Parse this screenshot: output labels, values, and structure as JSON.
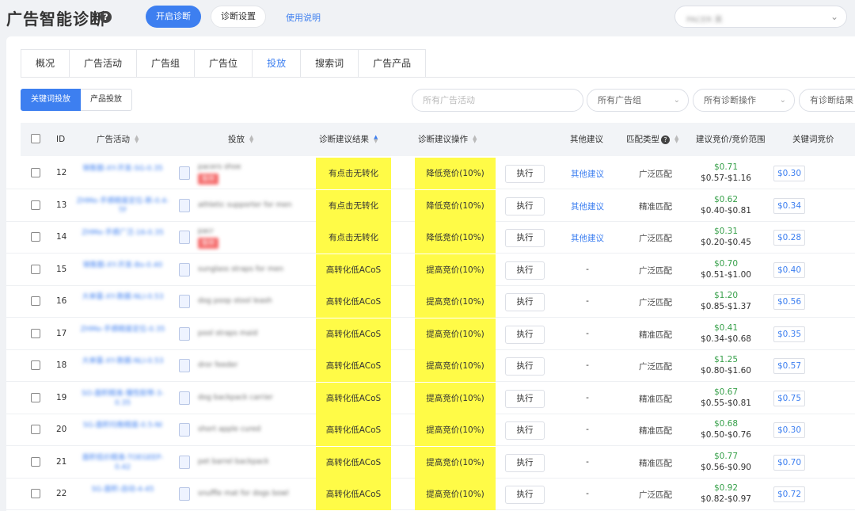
{
  "header": {
    "title": "广告智能诊断",
    "start_btn": "开启诊断",
    "settings_btn": "诊断设置",
    "guide_link": "使用说明",
    "store_value": "PACER 美"
  },
  "tabs": [
    "概况",
    "广告活动",
    "广告组",
    "广告位",
    "投放",
    "搜索词",
    "广告产品"
  ],
  "active_tab": "投放",
  "segment": {
    "keyword": "关键词投放",
    "product": "产品投放"
  },
  "filters": {
    "campaign_placeholder": "所有广告活动",
    "group": "所有广告组",
    "operation": "所有诊断操作",
    "result": "有诊断结果"
  },
  "columns": {
    "id": "ID",
    "campaign": "广告活动",
    "target": "投放",
    "result": "诊断建议结果",
    "operation": "诊断建议操作",
    "other": "其他建议",
    "match": "匹配类型",
    "suggest": "建议竞价/竞价范围",
    "bid": "关键词竞价"
  },
  "exec_label": "执行",
  "rows": [
    {
      "id": "12",
      "campaign": "销售额-XY-开发-SG-0.35",
      "target": "pacers shoe",
      "badge": "暂停",
      "result": "有点击无转化",
      "operation": "降低竞价(10%)",
      "other": "其他建议",
      "match": "广泛匹配",
      "price": "$0.71",
      "range": "$0.57-$1.16",
      "bid": "$0.30"
    },
    {
      "id": "13",
      "campaign": "ZHMe-手感精度定位-新-0.4-TF",
      "target": "athletic supporter for men",
      "badge": "",
      "result": "有点击无转化",
      "operation": "降低竞价(10%)",
      "other": "其他建议",
      "match": "精准匹配",
      "price": "$0.62",
      "range": "$0.40-$0.81",
      "bid": "$0.34"
    },
    {
      "id": "14",
      "campaign": "ZHMe-手感广泛-16-0.35",
      "target": "pacr",
      "badge": "暂停",
      "result": "有点击无转化",
      "operation": "降低竞价(10%)",
      "other": "其他建议",
      "match": "广泛匹配",
      "price": "$0.31",
      "range": "$0.20-$0.45",
      "bid": "$0.28"
    },
    {
      "id": "15",
      "campaign": "销售额-XY-开发-Bo-0.40",
      "target": "sunglass straps for men",
      "badge": "",
      "result": "高转化低ACoS",
      "operation": "提高竞价(10%)",
      "other": "-",
      "match": "广泛匹配",
      "price": "$0.70",
      "range": "$0.51-$1.00",
      "bid": "$0.40"
    },
    {
      "id": "16",
      "campaign": "大单量-XY-数据-NLI-0.53",
      "target": "dog poop stool leash",
      "badge": "",
      "result": "高转化低ACoS",
      "operation": "提高竞价(10%)",
      "other": "-",
      "match": "广泛匹配",
      "price": "$1.20",
      "range": "$0.85-$1.37",
      "bid": "$0.56"
    },
    {
      "id": "17",
      "campaign": "ZHMe-手感精度定位-0.35",
      "target": "pool straps maid",
      "badge": "",
      "result": "高转化低ACoS",
      "operation": "提高竞价(10%)",
      "other": "-",
      "match": "精准匹配",
      "price": "$0.41",
      "range": "$0.34-$0.68",
      "bid": "$0.35"
    },
    {
      "id": "18",
      "campaign": "大单量-XY-数据-NLI-0.53",
      "target": "dror feeder",
      "badge": "",
      "result": "高转化低ACoS",
      "operation": "提高竞价(10%)",
      "other": "-",
      "match": "广泛匹配",
      "price": "$1.25",
      "range": "$0.80-$1.60",
      "bid": "$0.57"
    },
    {
      "id": "19",
      "campaign": "SO-面积精准-慢性胶带-3-0.35",
      "target": "dog backpack carrier",
      "badge": "",
      "result": "高转化低ACoS",
      "operation": "提高竞价(10%)",
      "other": "-",
      "match": "精准匹配",
      "price": "$0.67",
      "range": "$0.55-$0.81",
      "bid": "$0.75"
    },
    {
      "id": "20",
      "campaign": "SG-面积均衡精度-0.5-NI",
      "target": "short apple cured",
      "badge": "",
      "result": "高转化低ACoS",
      "operation": "提高竞价(10%)",
      "other": "-",
      "match": "精准匹配",
      "price": "$0.68",
      "range": "$0.50-$0.76",
      "bid": "$0.30"
    },
    {
      "id": "21",
      "campaign": "面积低价精准-TOEGEEP-0.42",
      "target": "pet barrel backpack",
      "badge": "",
      "result": "高转化低ACoS",
      "operation": "提高竞价(10%)",
      "other": "-",
      "match": "精准匹配",
      "price": "$0.77",
      "range": "$0.56-$0.90",
      "bid": "$0.70"
    },
    {
      "id": "22",
      "campaign": "SG-面积-自动-4-45",
      "target": "snuffle mat for dogs bowl",
      "badge": "",
      "result": "高转化低ACoS",
      "operation": "提高竞价(10%)",
      "other": "-",
      "match": "广泛匹配",
      "price": "$0.92",
      "range": "$0.82-$0.97",
      "bid": "$0.72"
    }
  ]
}
